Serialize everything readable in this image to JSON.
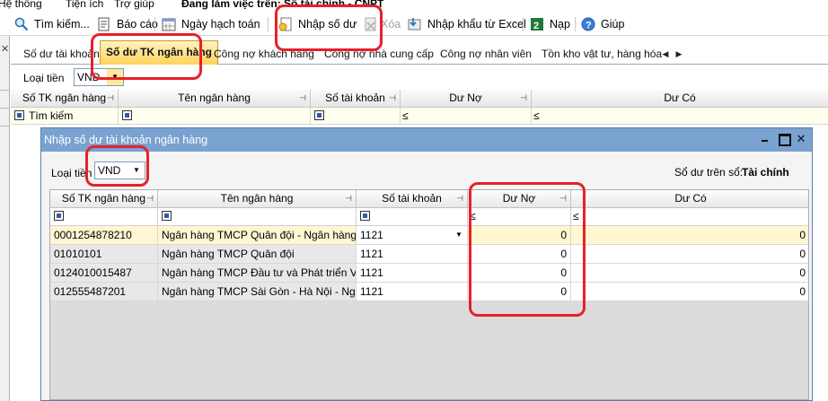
{
  "menu": {
    "items": [
      "Hệ thống",
      "Tiện ích",
      "Trợ giúp"
    ],
    "working_on": "Đang làm việc trên: Sổ tài chính - CNPT"
  },
  "toolbar": {
    "search": "Tìm kiếm...",
    "report": "Báo cáo",
    "posting_date": "Ngày hạch toán",
    "enter_balance": "Nhập số dư",
    "delete": "Xóa",
    "import_excel": "Nhập khẩu từ Excel",
    "load": "Nạp",
    "help": "Giúp"
  },
  "tabs": [
    "Số dư tài khoản",
    "Số dư TK ngân hàng",
    "Công nợ khách hàng",
    "Công nợ nhà cung cấp",
    "Công nợ nhân viên",
    "Tồn kho vật tư, hàng hóa"
  ],
  "currency": {
    "label": "Loại tiền",
    "value": "VND"
  },
  "main_grid": {
    "headers": [
      "Số TK ngân hàng",
      "Tên ngân hàng",
      "Số tài khoản",
      "Dư Nợ",
      "Dư Có"
    ],
    "filter_text": "Tìm kiếm",
    "filter_le": "≤"
  },
  "dialog": {
    "title": "Nhập số dư tài khoản ngân hàng",
    "currency_label": "Loại tiền",
    "currency_value": "VND",
    "book_label": "Sổ dư trên sổ:",
    "book_value": "Tài chính",
    "headers": [
      "Số TK ngân hàng",
      "Tên ngân hàng",
      "Số tài khoản",
      "Dư Nợ",
      "Dư Có"
    ],
    "filter_le": "≤",
    "rows": [
      {
        "account_no": "0001254878210",
        "bank_name": "Ngân hàng TMCP Quân đội - Ngân hàng",
        "gl_account": "1121",
        "debit": "0",
        "credit": "0"
      },
      {
        "account_no": "01010101",
        "bank_name": "Ngân hàng TMCP Quân đội",
        "gl_account": "1121",
        "debit": "0",
        "credit": "0"
      },
      {
        "account_no": "0124010015487",
        "bank_name": "Ngân hàng TMCP Đầu tư và Phát triển Việ",
        "gl_account": "1121",
        "debit": "0",
        "credit": "0"
      },
      {
        "account_no": "012555487201",
        "bank_name": "Ngân hàng TMCP  Sài Gòn - Hà Nội - Ngâ",
        "gl_account": "1121",
        "debit": "0",
        "credit": "0"
      }
    ]
  },
  "colors": {
    "highlight": "#e8202a",
    "active_tab": "#ffd25a",
    "dialog_title": "#7aa2d0"
  }
}
